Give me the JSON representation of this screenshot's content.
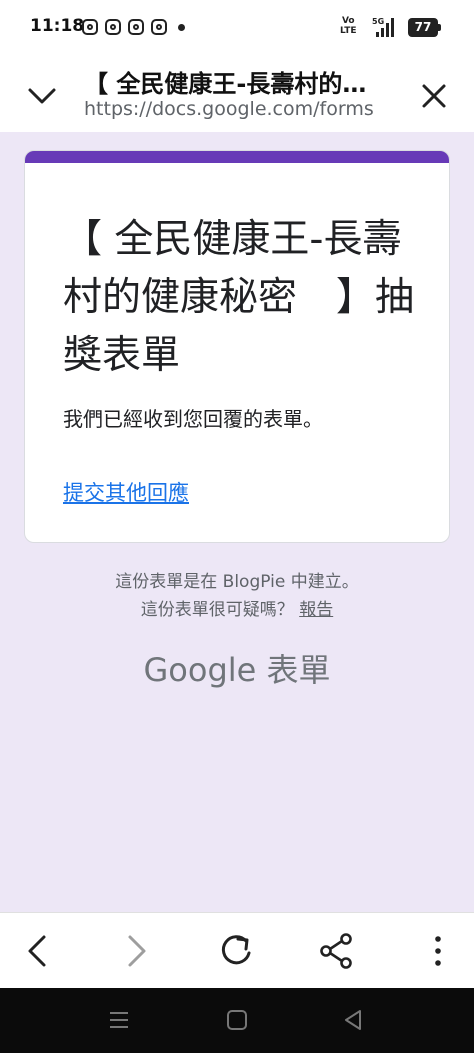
{
  "status_bar": {
    "time": "11:18",
    "volte_top": "Vo",
    "volte_bottom": "LTE",
    "network": "5G",
    "battery": "77",
    "notifications": [
      "instagram-icon",
      "instagram-icon",
      "instagram-icon",
      "instagram-icon",
      "dot-icon"
    ]
  },
  "browser": {
    "tab_title": "【 全民健康王-長壽村的健康秘密 】抽獎表單",
    "url": "https://docs.google.com/forms"
  },
  "form": {
    "title": "【 全民健康王-長壽村的健康秘密　】抽獎表單",
    "confirmation": "我們已經收到您回覆的表單。",
    "other_response_link": "提交其他回應",
    "accent_color": "#673ab7"
  },
  "footer": {
    "created_by": "這份表單是在 BlogPie 中建立。",
    "suspicious_prefix": "這份表單很可疑嗎？",
    "report_link": "報告",
    "brand": "Google 表單"
  },
  "toolbar": {
    "back": "back-arrow-icon",
    "forward": "forward-arrow-icon",
    "refresh": "refresh-icon",
    "share": "share-icon",
    "menu": "more-vert-icon"
  }
}
